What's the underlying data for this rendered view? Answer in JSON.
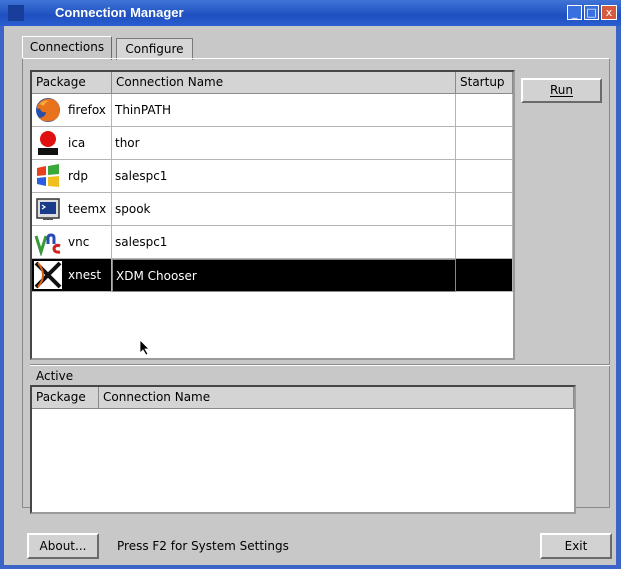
{
  "window": {
    "title": "Connection Manager",
    "minimize_glyph": "_",
    "maximize_glyph": "□",
    "close_glyph": "x"
  },
  "tabs": [
    {
      "label": "Connections",
      "active": true
    },
    {
      "label": "Configure",
      "active": false
    }
  ],
  "connections": {
    "columns": [
      "Package",
      "Connection Name",
      "Startup"
    ],
    "rows": [
      {
        "package": "firefox",
        "icon": "firefox-icon",
        "connection_name": "ThinPATH",
        "startup": "",
        "selected": false
      },
      {
        "package": "ica",
        "icon": "ica-icon",
        "connection_name": "thor",
        "startup": "",
        "selected": false
      },
      {
        "package": "rdp",
        "icon": "windows-flag-icon",
        "connection_name": "salespc1",
        "startup": "",
        "selected": false
      },
      {
        "package": "teemx",
        "icon": "terminal-icon",
        "connection_name": "spook",
        "startup": "",
        "selected": false
      },
      {
        "package": "vnc",
        "icon": "realvnc-icon",
        "connection_name": "salespc1",
        "startup": "",
        "selected": false
      },
      {
        "package": "xnest",
        "icon": "x-window-icon",
        "connection_name": "XDM Chooser",
        "startup": "",
        "selected": true
      }
    ]
  },
  "run_button": {
    "label": "Run",
    "mnemonic": "R"
  },
  "active": {
    "label": "Active",
    "columns": [
      "Package",
      "Connection Name"
    ],
    "rows": []
  },
  "footer": {
    "about_label": "About...",
    "hint": "Press F2 for System Settings",
    "exit_label": "Exit"
  },
  "colors": {
    "titlebar": "#1f4fc0",
    "window_bg": "#c8c8c8",
    "selection": "#000000"
  }
}
